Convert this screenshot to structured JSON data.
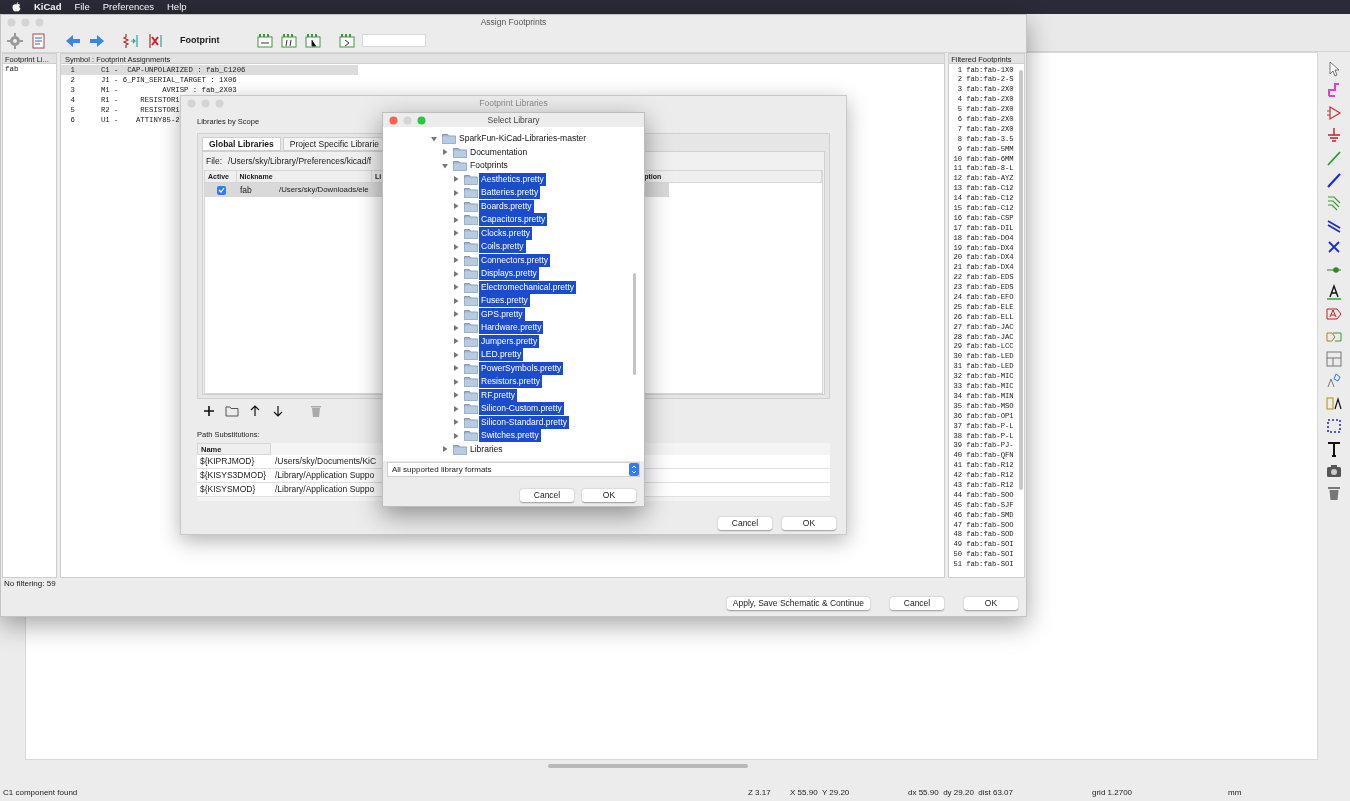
{
  "menu_bar": {
    "items": [
      "KiCad",
      "File",
      "Preferences",
      "Help"
    ]
  },
  "assign_window": {
    "title": "Assign Footprints",
    "toolbar_label": "Footprint",
    "library_panel": {
      "header": "Footprint Li...",
      "items": [
        "fab"
      ]
    },
    "symbols": {
      "header": "Symbol : Footprint Assignments",
      "rows": [
        {
          "number": "1",
          "text": "C1 -  CAP-UNPOLARIZED : fab_C1206",
          "selected": true
        },
        {
          "number": "2",
          "text": "J1 - 6_PIN_SERIAL_TARGET : 1X06",
          "selected": false
        },
        {
          "number": "3",
          "text": "M1 -          AVRISP : fab_2X03",
          "selected": false
        },
        {
          "number": "4",
          "text": "R1 -     RESISTOR1",
          "selected": false
        },
        {
          "number": "5",
          "text": "R2 -     RESISTOR1",
          "selected": false
        },
        {
          "number": "6",
          "text": "U1 -    ATTINY85-2",
          "selected": false
        }
      ]
    },
    "filtered": {
      "header": "Filtered Footprints",
      "rows": [
        {
          "number": "1",
          "name": "fab:fab-1X0"
        },
        {
          "number": "2",
          "name": "fab:fab-2-S"
        },
        {
          "number": "3",
          "name": "fab:fab-2X0"
        },
        {
          "number": "4",
          "name": "fab:fab-2X0"
        },
        {
          "number": "5",
          "name": "fab:fab-2X0"
        },
        {
          "number": "6",
          "name": "fab:fab-2X0"
        },
        {
          "number": "7",
          "name": "fab:fab-2X0"
        },
        {
          "number": "8",
          "name": "fab:fab-3.5"
        },
        {
          "number": "9",
          "name": "fab:fab-5MM"
        },
        {
          "number": "10",
          "name": "fab:fab-6MM"
        },
        {
          "number": "11",
          "name": "fab:fab-8-L"
        },
        {
          "number": "12",
          "name": "fab:fab-AYZ"
        },
        {
          "number": "13",
          "name": "fab:fab-C12"
        },
        {
          "number": "14",
          "name": "fab:fab-C12"
        },
        {
          "number": "15",
          "name": "fab:fab-C12"
        },
        {
          "number": "16",
          "name": "fab:fab-CSP"
        },
        {
          "number": "17",
          "name": "fab:fab-DIL"
        },
        {
          "number": "18",
          "name": "fab:fab-DO4"
        },
        {
          "number": "19",
          "name": "fab:fab-DX4"
        },
        {
          "number": "20",
          "name": "fab:fab-DX4"
        },
        {
          "number": "21",
          "name": "fab:fab-DX4"
        },
        {
          "number": "22",
          "name": "fab:fab-EDS"
        },
        {
          "number": "23",
          "name": "fab:fab-EDS"
        },
        {
          "number": "24",
          "name": "fab:fab-EFO"
        },
        {
          "number": "25",
          "name": "fab:fab-ELE"
        },
        {
          "number": "26",
          "name": "fab:fab-ELL"
        },
        {
          "number": "27",
          "name": "fab:fab-JAC"
        },
        {
          "number": "28",
          "name": "fab:fab-JAC"
        },
        {
          "number": "29",
          "name": "fab:fab-LCC"
        },
        {
          "number": "30",
          "name": "fab:fab-LED"
        },
        {
          "number": "31",
          "name": "fab:fab-LED"
        },
        {
          "number": "32",
          "name": "fab:fab-MIC"
        },
        {
          "number": "33",
          "name": "fab:fab-MIC"
        },
        {
          "number": "34",
          "name": "fab:fab-MIN"
        },
        {
          "number": "35",
          "name": "fab:fab-MSO"
        },
        {
          "number": "36",
          "name": "fab:fab-OP1"
        },
        {
          "number": "37",
          "name": "fab:fab-P-L"
        },
        {
          "number": "38",
          "name": "fab:fab-P-L"
        },
        {
          "number": "39",
          "name": "fab:fab-PJ-"
        },
        {
          "number": "40",
          "name": "fab:fab-QFN"
        },
        {
          "number": "41",
          "name": "fab:fab-R12"
        },
        {
          "number": "42",
          "name": "fab:fab-R12"
        },
        {
          "number": "43",
          "name": "fab:fab-R12"
        },
        {
          "number": "44",
          "name": "fab:fab-SOO"
        },
        {
          "number": "45",
          "name": "fab:fab-SJF"
        },
        {
          "number": "46",
          "name": "fab:fab-SMD"
        },
        {
          "number": "47",
          "name": "fab:fab-SOO"
        },
        {
          "number": "48",
          "name": "fab:fab-SOD"
        },
        {
          "number": "49",
          "name": "fab:fab-SOI"
        },
        {
          "number": "50",
          "name": "fab:fab-SOI"
        },
        {
          "number": "51",
          "name": "fab:fab-SOI"
        }
      ]
    },
    "status": "No filtering: 59",
    "buttons": [
      "Apply, Save Schematic & Continue",
      "Cancel",
      "OK"
    ]
  },
  "footprint_libraries": {
    "title": "Footprint Libraries",
    "scope_label": "Libraries by Scope",
    "tabs": [
      {
        "label": "Global Libraries",
        "selected": true
      },
      {
        "label": "Project Specific Librarie",
        "selected": false
      }
    ],
    "file_label": "File:",
    "file_path": "/Users/sky/Library/Preferences/kicad/f",
    "columns": [
      "Active",
      "Nickname",
      "Li",
      "ption"
    ],
    "rows": [
      {
        "active": true,
        "nickname": "fab",
        "path": "/Users/sky/Downloads/ele",
        "selected": true
      }
    ],
    "path_label": "Path Substitutions:",
    "path_columns": [
      "Name"
    ],
    "paths": [
      {
        "name": "${KIPRJMOD}",
        "value": "/Users/sky/Documents/KiC"
      },
      {
        "name": "${KISYS3DMOD}",
        "value": "/Library/Application Suppo"
      },
      {
        "name": "${KISYSMOD}",
        "value": "/Library/Application Suppo"
      }
    ],
    "buttons": [
      "Cancel",
      "OK"
    ]
  },
  "select_library": {
    "title": "Select Library",
    "tree": [
      {
        "label": "SparkFun-KiCad-Libraries-master",
        "expanded": true,
        "selected": false,
        "children": [
          {
            "label": "Documentation",
            "expanded": false,
            "selected": false
          },
          {
            "label": "Footprints",
            "expanded": true,
            "selected": false,
            "children": [
              {
                "label": "Aesthetics.pretty",
                "expanded": false,
                "selected": true
              },
              {
                "label": "Batteries.pretty",
                "expanded": false,
                "selected": true
              },
              {
                "label": "Boards.pretty",
                "expanded": false,
                "selected": true
              },
              {
                "label": "Capacitors.pretty",
                "expanded": false,
                "selected": true
              },
              {
                "label": "Clocks.pretty",
                "expanded": false,
                "selected": true
              },
              {
                "label": "Coils.pretty",
                "expanded": false,
                "selected": true
              },
              {
                "label": "Connectors.pretty",
                "expanded": false,
                "selected": true
              },
              {
                "label": "Displays.pretty",
                "expanded": false,
                "selected": true
              },
              {
                "label": "Electromechanical.pretty",
                "expanded": false,
                "selected": true
              },
              {
                "label": "Fuses.pretty",
                "expanded": false,
                "selected": true
              },
              {
                "label": "GPS.pretty",
                "expanded": false,
                "selected": true
              },
              {
                "label": "Hardware.pretty",
                "expanded": false,
                "selected": true
              },
              {
                "label": "Jumpers.pretty",
                "expanded": false,
                "selected": true
              },
              {
                "label": "LED.pretty",
                "expanded": false,
                "selected": true
              },
              {
                "label": "PowerSymbols.pretty",
                "expanded": false,
                "selected": true
              },
              {
                "label": "Resistors.pretty",
                "expanded": false,
                "selected": true
              },
              {
                "label": "RF.pretty",
                "expanded": false,
                "selected": true
              },
              {
                "label": "Silicon-Custom.pretty",
                "expanded": false,
                "selected": true
              },
              {
                "label": "Silicon-Standard.pretty",
                "expanded": false,
                "selected": true
              },
              {
                "label": "Switches.pretty",
                "expanded": false,
                "selected": true
              }
            ]
          },
          {
            "label": "Libraries",
            "expanded": false,
            "selected": false
          }
        ]
      }
    ],
    "format": "All supported library formats",
    "buttons": [
      "Cancel",
      "OK"
    ]
  },
  "status_bar": [
    "C1 component found",
    "Z 3.17",
    "X 55.90  Y 29.20",
    "dx 55.90  dy 29.20  dist 63.07",
    "grid 1.2700",
    "mm"
  ]
}
